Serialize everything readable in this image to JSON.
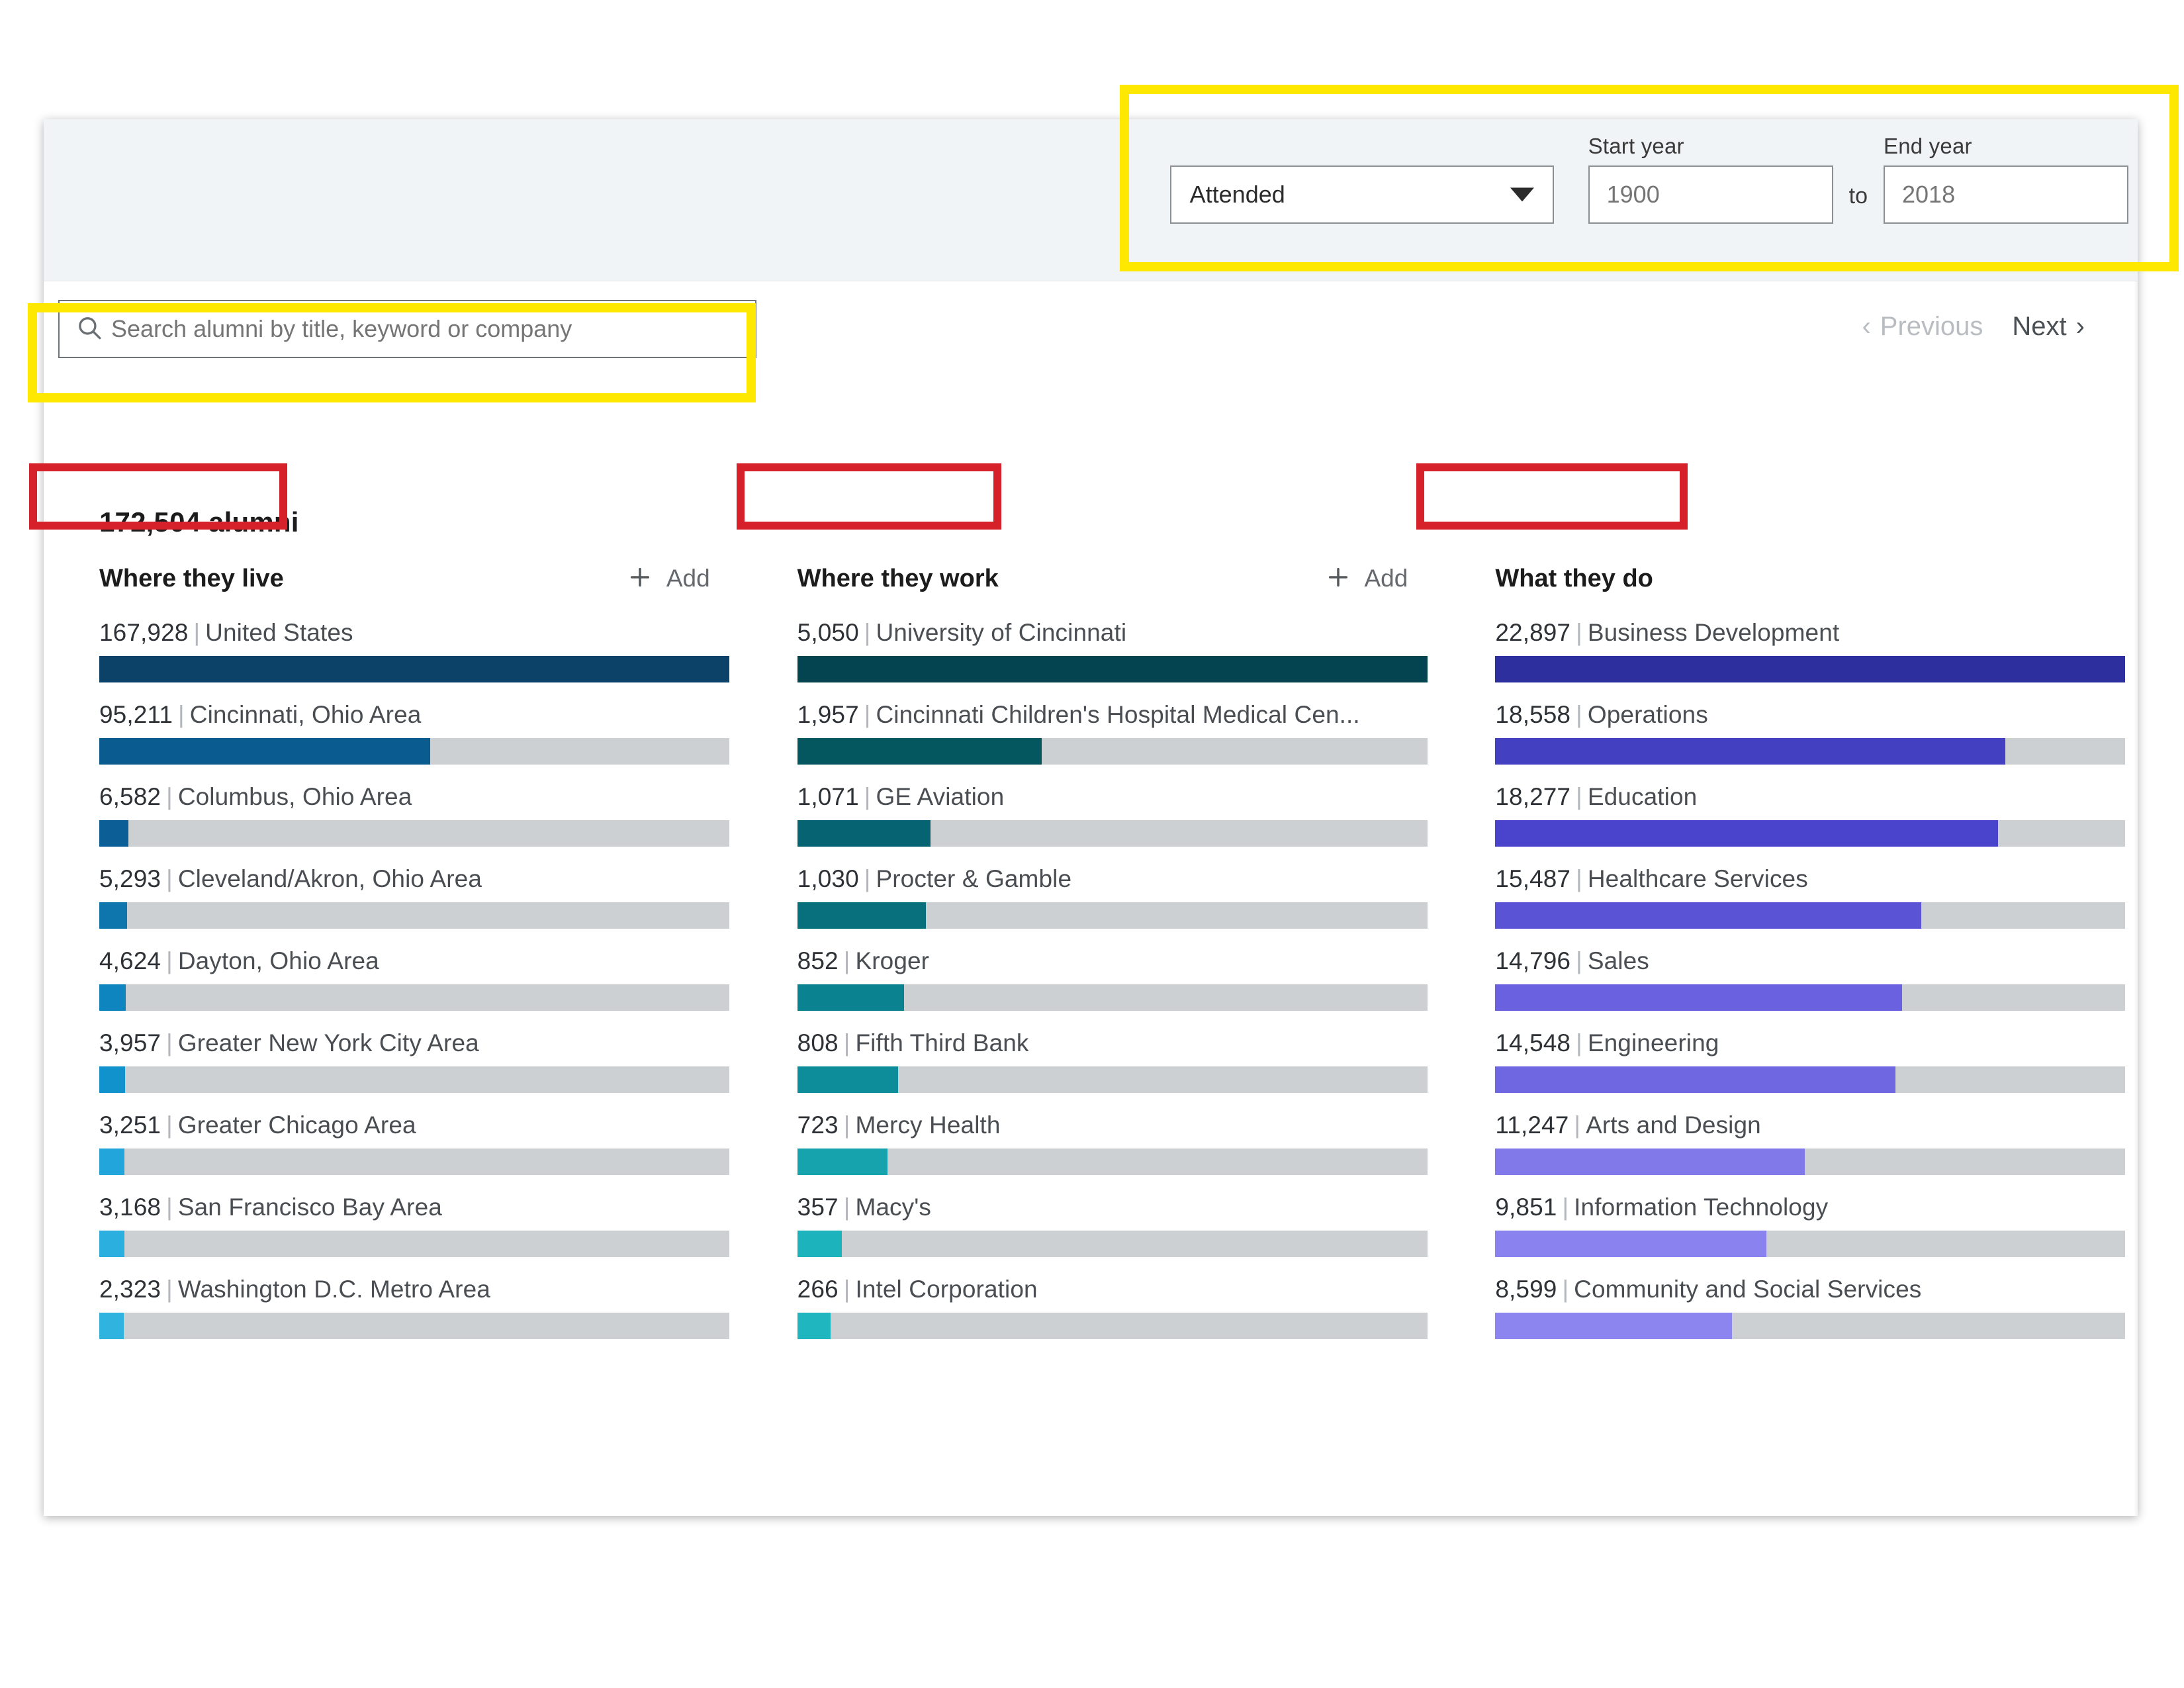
{
  "filters": {
    "attended_label": "Attended",
    "attended_options": [
      "Attended"
    ],
    "start_year_label": "Start year",
    "start_year_value": "1900",
    "to_label": "to",
    "end_year_label": "End year",
    "end_year_value": "2018"
  },
  "search": {
    "placeholder": "Search alumni by title, keyword or company",
    "value": "",
    "icon": "search-icon"
  },
  "pagination": {
    "previous_label": "Previous",
    "next_label": "Next",
    "prev_chevron": "‹",
    "next_chevron": "›"
  },
  "summary": {
    "alumni_count": "172,504 alumni"
  },
  "add_label": "Add",
  "colors": {
    "live_bar": "#0d4268",
    "work_bar": "#034450",
    "do_bar": "#2e2f9e",
    "track": "#cdd0d3",
    "annotation_yellow": "#ffe800",
    "annotation_red": "#d6212a"
  },
  "chart_data": [
    {
      "type": "bar",
      "title": "Where they live",
      "has_add_button": true,
      "orientation": "horizontal",
      "max_value": 167928,
      "categories": [
        "United States",
        "Cincinnati, Ohio Area",
        "Columbus, Ohio Area",
        "Cleveland/Akron, Ohio Area",
        "Dayton, Ohio Area",
        "Greater New York City Area",
        "Greater Chicago Area",
        "San Francisco Bay Area",
        "Washington D.C. Metro Area"
      ],
      "values": [
        167928,
        95211,
        6582,
        5293,
        4624,
        3957,
        3251,
        3168,
        2323
      ],
      "labels": [
        "167,928",
        "95,211",
        "6,582",
        "5,293",
        "4,624",
        "3,957",
        "3,251",
        "3,168",
        "2,323"
      ],
      "bar_colors": [
        "#0d4268",
        "#0a5b8f",
        "#0b5f96",
        "#0f76ad",
        "#0f85bf",
        "#1292cc",
        "#21a5da",
        "#2aafdf",
        "#31b3e0"
      ],
      "fill_pct": [
        100,
        52.5,
        4.6,
        4.4,
        4.2,
        4.1,
        4.0,
        4.0,
        3.9
      ]
    },
    {
      "type": "bar",
      "title": "Where they work",
      "has_add_button": true,
      "orientation": "horizontal",
      "max_value": 5050,
      "categories": [
        "University of Cincinnati",
        "Cincinnati Children's Hospital Medical Cen...",
        "GE Aviation",
        "Procter & Gamble",
        "Kroger",
        "Fifth Third Bank",
        "Mercy Health",
        "Macy's",
        "Intel Corporation"
      ],
      "values": [
        5050,
        1957,
        1071,
        1030,
        852,
        808,
        723,
        357,
        266
      ],
      "labels": [
        "5,050",
        "1,957",
        "1,071",
        "1,030",
        "852",
        "808",
        "723",
        "357",
        "266"
      ],
      "bar_colors": [
        "#034450",
        "#04565f",
        "#066371",
        "#07707c",
        "#0b8290",
        "#0d8d99",
        "#17a3ad",
        "#1db3bd",
        "#1fb6c0"
      ],
      "fill_pct": [
        100,
        38.8,
        21.2,
        20.4,
        16.9,
        16.0,
        14.3,
        7.1,
        5.3
      ]
    },
    {
      "type": "bar",
      "title": "What they do",
      "has_add_button": false,
      "orientation": "horizontal",
      "max_value": 22897,
      "categories": [
        "Business Development",
        "Operations",
        "Education",
        "Healthcare Services",
        "Sales",
        "Engineering",
        "Arts and Design",
        "Information Technology",
        "Community and Social Services"
      ],
      "values": [
        22897,
        18558,
        18277,
        15487,
        14796,
        14548,
        11247,
        9851,
        8599
      ],
      "labels": [
        "22,897",
        "18,558",
        "18,277",
        "15,487",
        "14,796",
        "14,548",
        "11,247",
        "9,851",
        "8,599"
      ],
      "bar_colors": [
        "#2e2f9e",
        "#4440c2",
        "#4a43cb",
        "#5a53d6",
        "#6a61e0",
        "#6f66e2",
        "#8179ea",
        "#8a82ee",
        "#8c84ef"
      ],
      "fill_pct": [
        100,
        81.0,
        79.8,
        67.6,
        64.6,
        63.5,
        49.1,
        43.0,
        37.6
      ]
    }
  ]
}
